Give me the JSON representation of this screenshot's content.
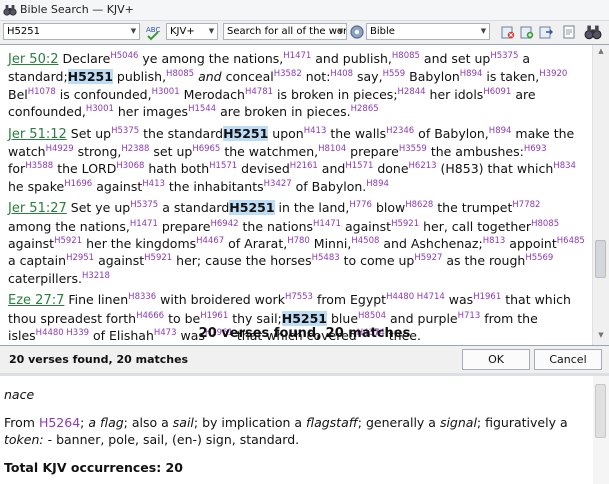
{
  "window": {
    "title": "Bible Search — KJV+"
  },
  "toolbar": {
    "search_value": "H5251",
    "version": "KJV+",
    "search_mode": "Search for all of the words",
    "scope": "Bible"
  },
  "verses": [
    {
      "ref": "Jer 50:2",
      "segments": [
        [
          "t",
          " Declare"
        ],
        [
          "s",
          "H5046"
        ],
        [
          "t",
          " ye among the nations,"
        ],
        [
          "s",
          "H1471"
        ],
        [
          "t",
          " and publish,"
        ],
        [
          "s",
          "H8085"
        ],
        [
          "t",
          " and set up"
        ],
        [
          "s",
          "H5375"
        ],
        [
          "t",
          " a standard;"
        ],
        [
          "h",
          "H5251"
        ],
        [
          "t",
          " publish,"
        ],
        [
          "s",
          "H8085"
        ],
        [
          "t",
          " "
        ],
        [
          "i",
          "and"
        ],
        [
          "t",
          " conceal"
        ],
        [
          "s",
          "H3582"
        ],
        [
          "t",
          " not:"
        ],
        [
          "s",
          "H408"
        ],
        [
          "t",
          " say,"
        ],
        [
          "s",
          "H559"
        ],
        [
          "t",
          " Babylon"
        ],
        [
          "s",
          "H894"
        ],
        [
          "t",
          " is taken,"
        ],
        [
          "s",
          "H3920"
        ],
        [
          "t",
          " Bel"
        ],
        [
          "s",
          "H1078"
        ],
        [
          "t",
          " is confounded,"
        ],
        [
          "s",
          "H3001"
        ],
        [
          "t",
          " Merodach"
        ],
        [
          "s",
          "H4781"
        ],
        [
          "t",
          " is broken in pieces;"
        ],
        [
          "s",
          "H2844"
        ],
        [
          "t",
          " her idols"
        ],
        [
          "s",
          "H6091"
        ],
        [
          "t",
          " are confounded,"
        ],
        [
          "s",
          "H3001"
        ],
        [
          "t",
          " her images"
        ],
        [
          "s",
          "H1544"
        ],
        [
          "t",
          " are broken in pieces."
        ],
        [
          "s",
          "H2865"
        ]
      ]
    },
    {
      "ref": "Jer 51:12",
      "segments": [
        [
          "t",
          " Set up"
        ],
        [
          "s",
          "H5375"
        ],
        [
          "t",
          " the standard"
        ],
        [
          "h",
          "H5251"
        ],
        [
          "t",
          " upon"
        ],
        [
          "s",
          "H413"
        ],
        [
          "t",
          " the walls"
        ],
        [
          "s",
          "H2346"
        ],
        [
          "t",
          " of Babylon,"
        ],
        [
          "s",
          "H894"
        ],
        [
          "t",
          " make the watch"
        ],
        [
          "s",
          "H4929"
        ],
        [
          "t",
          " strong,"
        ],
        [
          "s",
          "H2388"
        ],
        [
          "t",
          " set up"
        ],
        [
          "s",
          "H6965"
        ],
        [
          "t",
          " the watchmen,"
        ],
        [
          "s",
          "H8104"
        ],
        [
          "t",
          " prepare"
        ],
        [
          "s",
          "H3559"
        ],
        [
          "t",
          " the ambushes:"
        ],
        [
          "s",
          "H693"
        ],
        [
          "t",
          " for"
        ],
        [
          "s",
          "H3588"
        ],
        [
          "t",
          " the LORD"
        ],
        [
          "s",
          "H3068"
        ],
        [
          "t",
          " hath both"
        ],
        [
          "s",
          "H1571"
        ],
        [
          "t",
          " devised"
        ],
        [
          "s",
          "H2161"
        ],
        [
          "t",
          " and"
        ],
        [
          "s",
          "H1571"
        ],
        [
          "t",
          " done"
        ],
        [
          "s",
          "H6213"
        ],
        [
          "t",
          " (H853) that which"
        ],
        [
          "s",
          "H834"
        ],
        [
          "t",
          " he spake"
        ],
        [
          "s",
          "H1696"
        ],
        [
          "t",
          " against"
        ],
        [
          "s",
          "H413"
        ],
        [
          "t",
          " the inhabitants"
        ],
        [
          "s",
          "H3427"
        ],
        [
          "t",
          " of Babylon."
        ],
        [
          "s",
          "H894"
        ]
      ]
    },
    {
      "ref": "Jer 51:27",
      "segments": [
        [
          "t",
          " Set ye up"
        ],
        [
          "s",
          "H5375"
        ],
        [
          "t",
          " a standard"
        ],
        [
          "h",
          "H5251"
        ],
        [
          "t",
          " in the land,"
        ],
        [
          "s",
          "H776"
        ],
        [
          "t",
          " blow"
        ],
        [
          "s",
          "H8628"
        ],
        [
          "t",
          " the trumpet"
        ],
        [
          "s",
          "H7782"
        ],
        [
          "t",
          " among the nations,"
        ],
        [
          "s",
          "H1471"
        ],
        [
          "t",
          " prepare"
        ],
        [
          "s",
          "H6942"
        ],
        [
          "t",
          " the nations"
        ],
        [
          "s",
          "H1471"
        ],
        [
          "t",
          " against"
        ],
        [
          "s",
          "H5921"
        ],
        [
          "t",
          " her, call together"
        ],
        [
          "s",
          "H8085"
        ],
        [
          "t",
          " against"
        ],
        [
          "s",
          "H5921"
        ],
        [
          "t",
          " her the kingdoms"
        ],
        [
          "s",
          "H4467"
        ],
        [
          "t",
          " of Ararat,"
        ],
        [
          "s",
          "H780"
        ],
        [
          "t",
          " Minni,"
        ],
        [
          "s",
          "H4508"
        ],
        [
          "t",
          " and Ashchenaz;"
        ],
        [
          "s",
          "H813"
        ],
        [
          "t",
          " appoint"
        ],
        [
          "s",
          "H6485"
        ],
        [
          "t",
          " a captain"
        ],
        [
          "s",
          "H2951"
        ],
        [
          "t",
          " against"
        ],
        [
          "s",
          "H5921"
        ],
        [
          "t",
          " her; cause the horses"
        ],
        [
          "s",
          "H5483"
        ],
        [
          "t",
          " to come up"
        ],
        [
          "s",
          "H5927"
        ],
        [
          "t",
          " as the rough"
        ],
        [
          "s",
          "H5569"
        ],
        [
          "t",
          " caterpillers."
        ],
        [
          "s",
          "H3218"
        ]
      ]
    },
    {
      "ref": "Eze 27:7",
      "segments": [
        [
          "t",
          " Fine linen"
        ],
        [
          "s",
          "H8336"
        ],
        [
          "t",
          " with broidered work"
        ],
        [
          "s",
          "H7553"
        ],
        [
          "t",
          " from Egypt"
        ],
        [
          "s",
          "H4480 H4714"
        ],
        [
          "t",
          " was"
        ],
        [
          "s",
          "H1961"
        ],
        [
          "t",
          " that which thou spreadest forth"
        ],
        [
          "s",
          "H4666"
        ],
        [
          "t",
          " to be"
        ],
        [
          "s",
          "H1961"
        ],
        [
          "t",
          " thy sail;"
        ],
        [
          "h",
          "H5251"
        ],
        [
          "t",
          " blue"
        ],
        [
          "s",
          "H8504"
        ],
        [
          "t",
          " and purple"
        ],
        [
          "s",
          "H713"
        ],
        [
          "t",
          " from the isles"
        ],
        [
          "s",
          "H4480 H339"
        ],
        [
          "t",
          " of Elishah"
        ],
        [
          "s",
          "H473"
        ],
        [
          "t",
          " was"
        ],
        [
          "s",
          "H1961"
        ],
        [
          "t",
          " that which covered"
        ],
        [
          "s",
          "H4374"
        ],
        [
          "t",
          " thee."
        ]
      ]
    }
  ],
  "results_summary": "20 verses found, 20 matches",
  "statusbar": {
    "text": "20 verses found, 20 matches",
    "ok_label": "OK",
    "cancel_label": "Cancel"
  },
  "detail": {
    "word": "nace",
    "def_segments": [
      [
        "t",
        "From "
      ],
      [
        "l",
        "H5264"
      ],
      [
        "t",
        "; "
      ],
      [
        "i",
        "a flag"
      ],
      [
        "t",
        "; also a "
      ],
      [
        "i",
        "sail"
      ],
      [
        "t",
        "; by implication a "
      ],
      [
        "i",
        "flagstaff"
      ],
      [
        "t",
        "; generally a "
      ],
      [
        "i",
        "signal"
      ],
      [
        "t",
        "; figuratively a "
      ],
      [
        "i",
        "token:"
      ],
      [
        "t",
        " - banner, pole, sail, (en-) sign, standard."
      ]
    ],
    "total_label": "Total KJV occurrences: 20"
  }
}
